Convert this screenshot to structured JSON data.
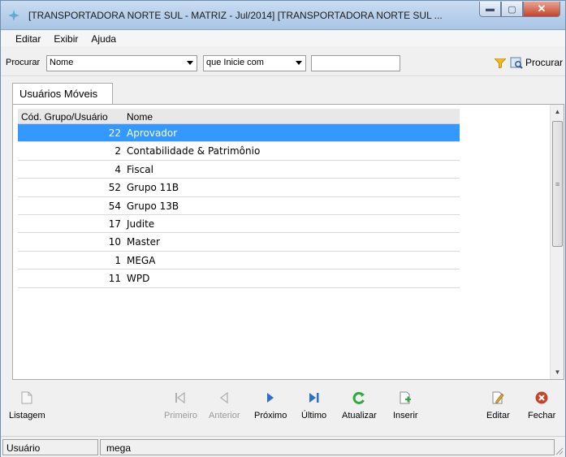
{
  "window": {
    "title": "[TRANSPORTADORA NORTE SUL -  MATRIZ - Jul/2014] [TRANSPORTADORA NORTE SUL ...",
    "minimize_glyph": "▬",
    "maximize_glyph": "▢",
    "close_glyph": "✕"
  },
  "menu": [
    "Editar",
    "Exibir",
    "Ajuda"
  ],
  "search": {
    "label": "Procurar",
    "field_value": "Nome",
    "mode_value": "que Inicie com",
    "text_value": "",
    "button_label": "Procurar"
  },
  "tab": {
    "label": "Usuários Móveis"
  },
  "grid": {
    "columns": [
      "Cód. Grupo/Usuário",
      "Nome"
    ],
    "rows": [
      {
        "code": "22",
        "name": "Aprovador",
        "selected": true
      },
      {
        "code": "2",
        "name": "Contabilidade & Patrimônio"
      },
      {
        "code": "4",
        "name": "Fiscal"
      },
      {
        "code": "52",
        "name": "Grupo 11B"
      },
      {
        "code": "54",
        "name": "Grupo 13B"
      },
      {
        "code": "17",
        "name": "Judite"
      },
      {
        "code": "10",
        "name": "Master"
      },
      {
        "code": "1",
        "name": "MEGA"
      },
      {
        "code": "11",
        "name": "WPD"
      }
    ]
  },
  "toolbar": {
    "listagem": "Listagem",
    "primeiro": "Primeiro",
    "anterior": "Anterior",
    "proximo": "Próximo",
    "ultimo": "Último",
    "atualizar": "Atualizar",
    "inserir": "Inserir",
    "editar": "Editar",
    "fechar": "Fechar"
  },
  "status": {
    "label": "Usuário",
    "value": "mega"
  },
  "colors": {
    "selection": "#3399ff",
    "close_red": "#c7432a",
    "refresh_green": "#2eaa3c",
    "nav_blue": "#2a6fd1"
  }
}
